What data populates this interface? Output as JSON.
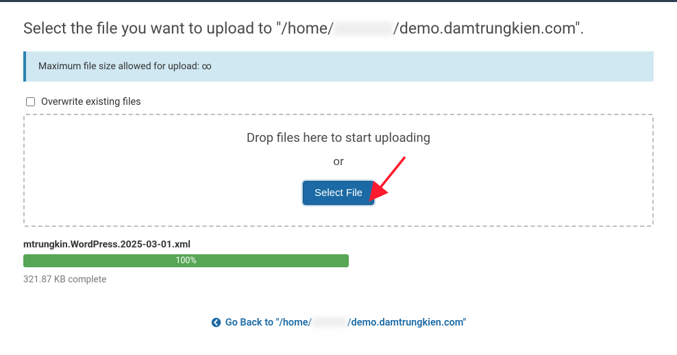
{
  "header": {
    "title_prefix": "Select the file you want to upload to \"",
    "path_prefix": "/home/",
    "path_suffix": "/demo.damtrungkien.com",
    "title_suffix": "\"."
  },
  "infobox": {
    "text": "Maximum file size allowed for upload: ∞"
  },
  "overwrite": {
    "label": "Overwrite existing files",
    "checked": false
  },
  "dropzone": {
    "drop_text": "Drop files here to start uploading",
    "or_text": "or",
    "button_label": "Select File"
  },
  "upload": {
    "file_name": "mtrungkin.WordPress.2025-03-01.xml",
    "progress_percent": 100,
    "progress_label": "100%",
    "status_text": "321.87 KB complete"
  },
  "goback": {
    "prefix": "Go Back to \"/home/",
    "suffix": "/demo.damtrungkien.com\""
  }
}
